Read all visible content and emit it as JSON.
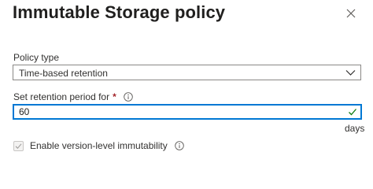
{
  "panel": {
    "title": "Immutable Storage policy",
    "close_icon": "close-icon"
  },
  "policy_type": {
    "label": "Policy type",
    "selected_value": "Time-based retention",
    "chevron_icon": "chevron-down-icon"
  },
  "retention": {
    "label": "Set retention period for",
    "required_marker": "*",
    "info_icon": "info-icon",
    "value": "60",
    "valid_icon": "checkmark-icon",
    "unit": "days"
  },
  "version_immutability": {
    "label": "Enable version-level immutability",
    "checked": true,
    "disabled": true,
    "info_icon": "info-icon"
  },
  "colors": {
    "focus_border": "#0078d4",
    "required": "#a4262c",
    "valid_check": "#107c10"
  }
}
